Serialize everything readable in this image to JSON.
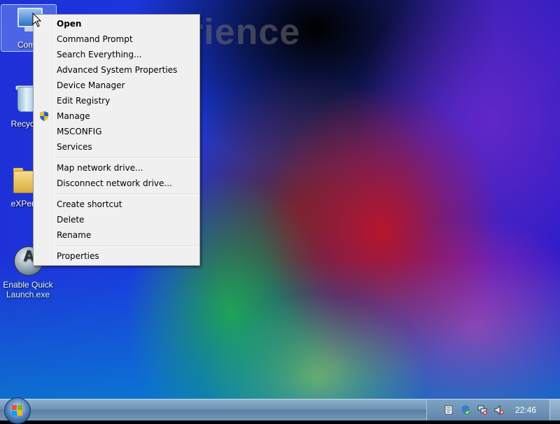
{
  "wallpaper": {
    "text": "rience"
  },
  "desktop_icons": [
    {
      "label": "Comp"
    },
    {
      "label": "Recycle"
    },
    {
      "label": "eXPerie"
    },
    {
      "label": "Enable Quick Launch.exe"
    }
  ],
  "context_menu": {
    "items": [
      {
        "label": "Open"
      },
      {
        "label": "Command Prompt"
      },
      {
        "label": "Search Everything..."
      },
      {
        "label": "Advanced System Properties"
      },
      {
        "label": "Device Manager"
      },
      {
        "label": "Edit Registry"
      },
      {
        "label": "Manage"
      },
      {
        "label": "MSCONFIG"
      },
      {
        "label": "Services"
      },
      {
        "label": "Map network drive..."
      },
      {
        "label": "Disconnect network drive..."
      },
      {
        "label": "Create shortcut"
      },
      {
        "label": "Delete"
      },
      {
        "label": "Rename"
      },
      {
        "label": "Properties"
      }
    ]
  },
  "taskbar": {
    "clock": "22:46",
    "tray_icons": [
      "notes-icon",
      "security-center-icon",
      "network-icon",
      "volume-muted-icon"
    ]
  },
  "colors": {
    "menu_bg": "#f0f0f0",
    "menu_border": "#979797",
    "taskbar": "#6f93b4"
  }
}
